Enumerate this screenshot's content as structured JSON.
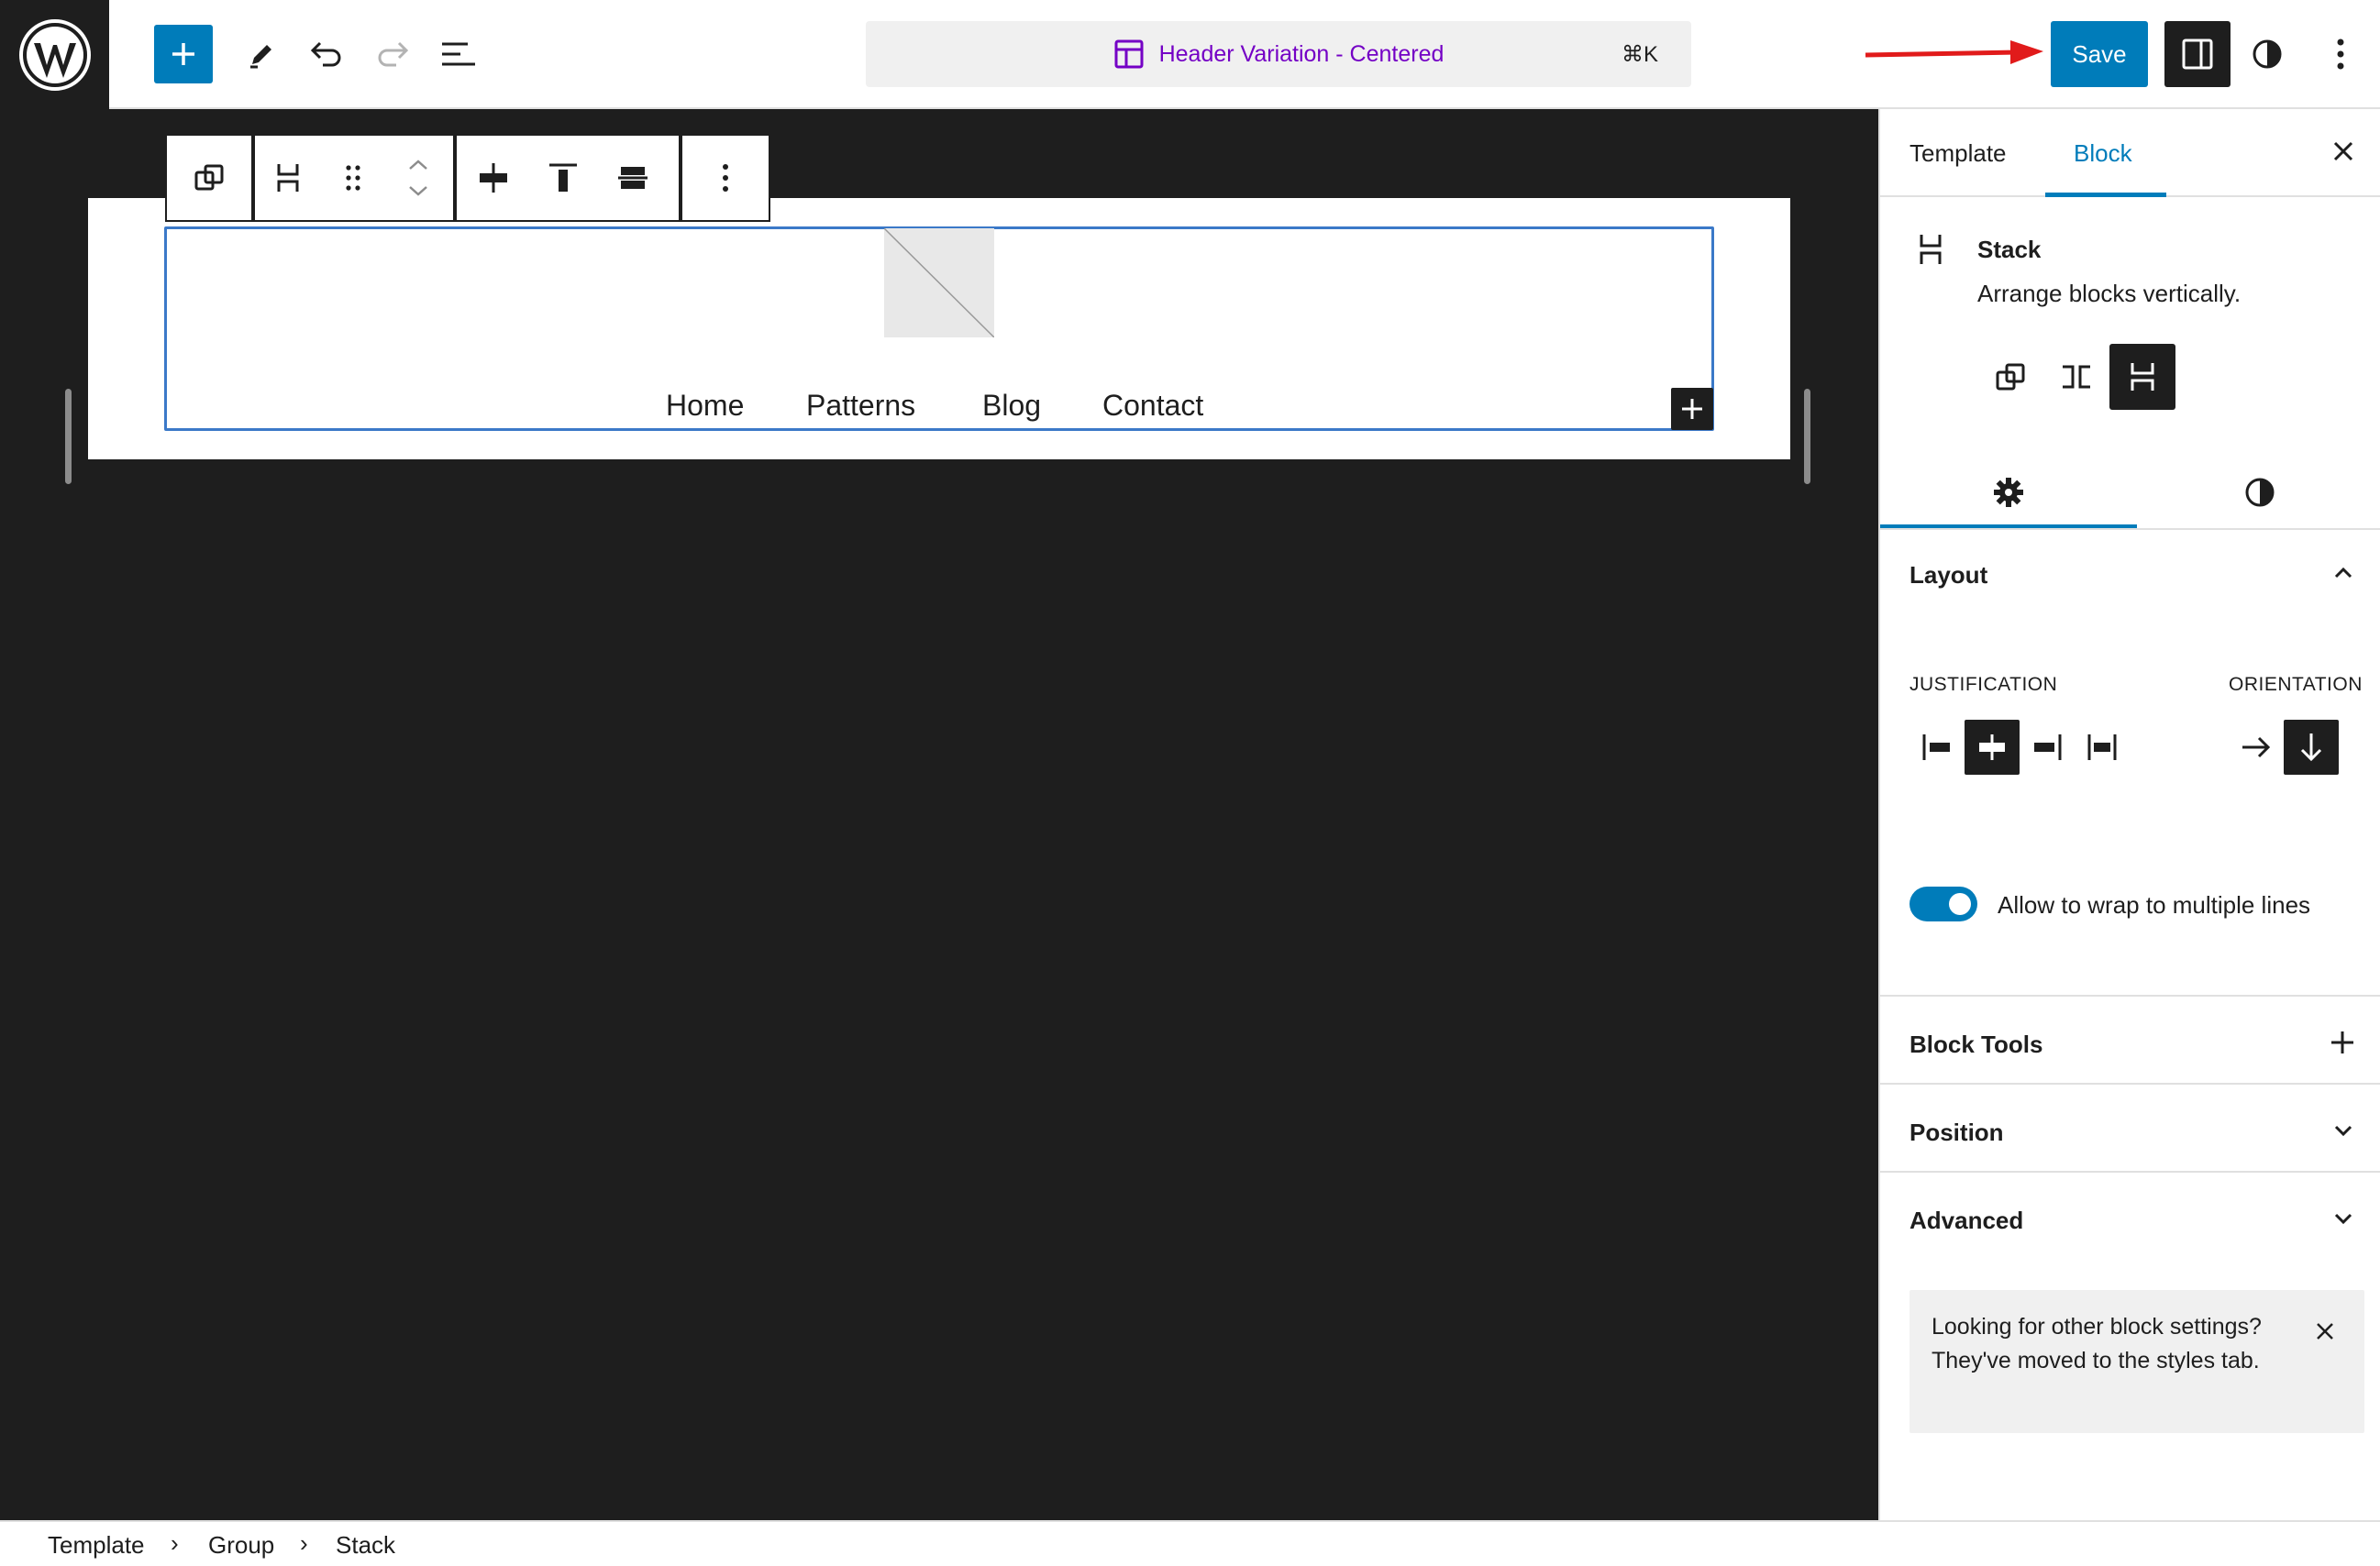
{
  "topbar": {
    "template_title": "Header Variation - Centered",
    "shortcut": "⌘K",
    "save_label": "Save"
  },
  "canvas": {
    "nav_items": [
      "Home",
      "Patterns",
      "Blog",
      "Contact"
    ]
  },
  "sidebar": {
    "tabs": [
      "Template",
      "Block"
    ],
    "active_tab": "Block",
    "block_name": "Stack",
    "block_description": "Arrange blocks vertically.",
    "layout_title": "Layout",
    "justification_label": "JUSTIFICATION",
    "orientation_label": "ORIENTATION",
    "wrap_label": "Allow to wrap to multiple lines",
    "wrap_enabled": true,
    "panels": [
      "Block Tools",
      "Position",
      "Advanced"
    ],
    "notice": "Looking for other block settings? They've moved to the styles tab."
  },
  "breadcrumbs": [
    "Template",
    "Group",
    "Stack"
  ],
  "colors": {
    "accent": "#007cba",
    "canvas_bg": "#1e1e1e",
    "title_purple": "#7400c5",
    "arrow_red": "#e11b1b"
  }
}
